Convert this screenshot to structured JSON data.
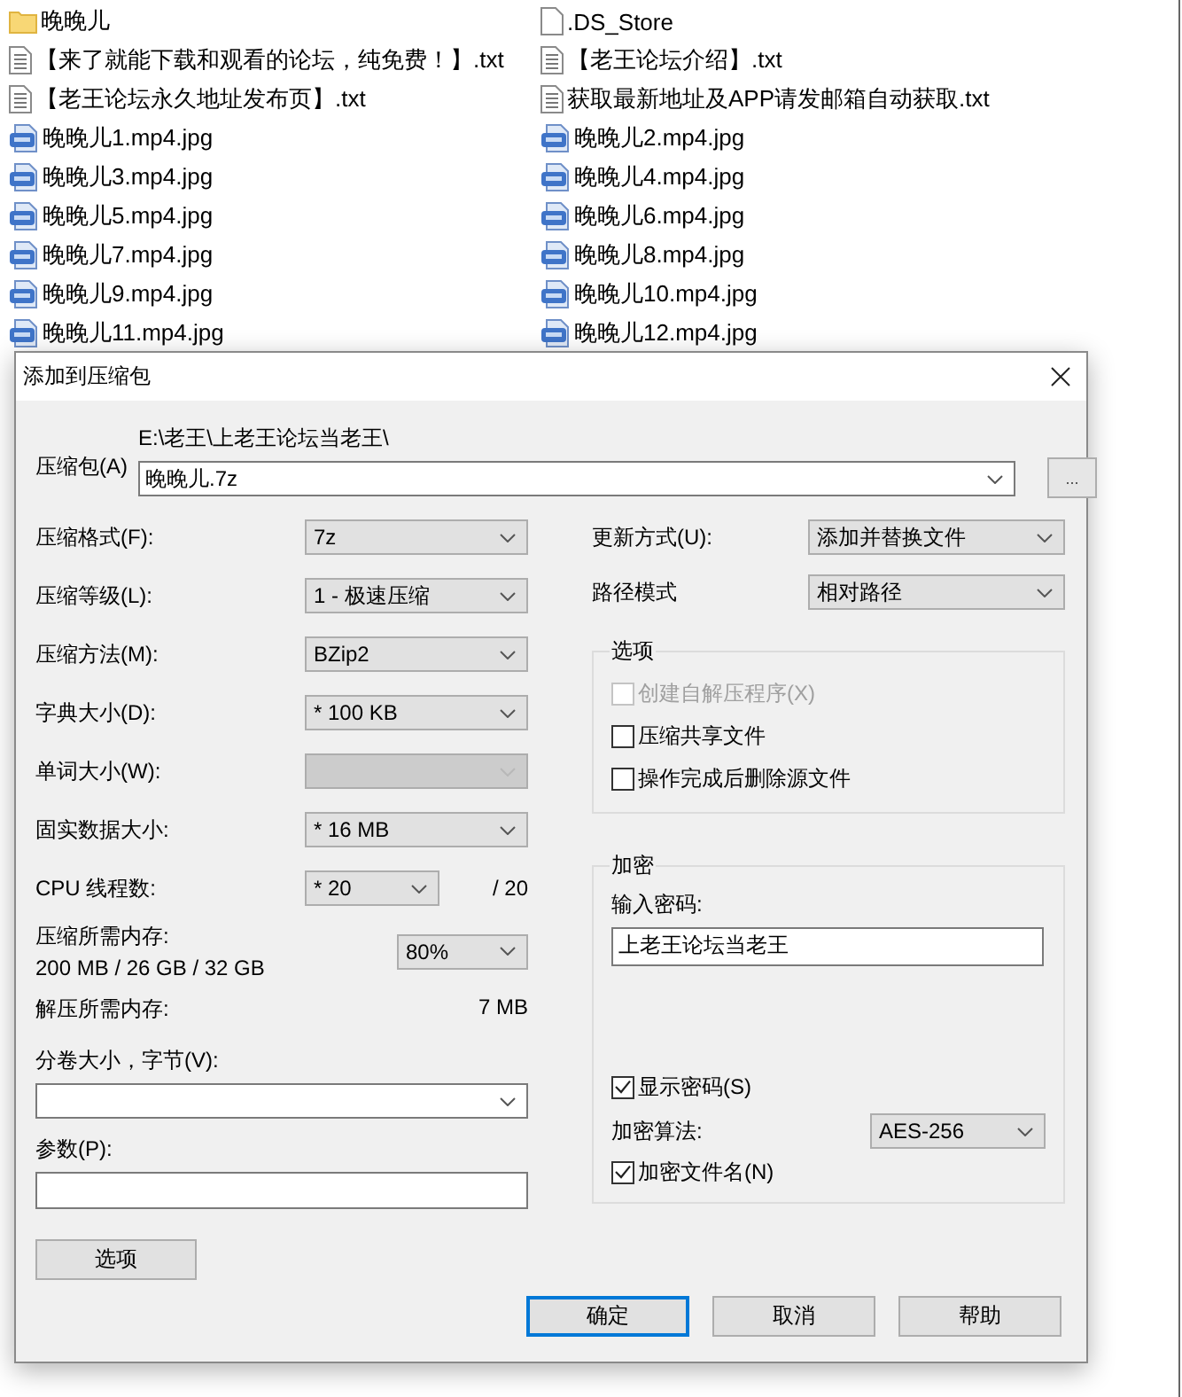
{
  "files": [
    {
      "name": "晚晚儿",
      "kind": "folder"
    },
    {
      "name": ".DS_Store",
      "kind": "file"
    },
    {
      "name": "【来了就能下载和观看的论坛，纯免费！】.txt",
      "kind": "text"
    },
    {
      "name": "【老王论坛介绍】.txt",
      "kind": "text"
    },
    {
      "name": "【老王论坛永久地址发布页】.txt",
      "kind": "text"
    },
    {
      "name": "获取最新地址及APP请发邮箱自动获取.txt",
      "kind": "text"
    },
    {
      "name": "晚晚儿1.mp4.jpg",
      "kind": "image"
    },
    {
      "name": "晚晚儿2.mp4.jpg",
      "kind": "image"
    },
    {
      "name": "晚晚儿3.mp4.jpg",
      "kind": "image"
    },
    {
      "name": "晚晚儿4.mp4.jpg",
      "kind": "image"
    },
    {
      "name": "晚晚儿5.mp4.jpg",
      "kind": "image"
    },
    {
      "name": "晚晚儿6.mp4.jpg",
      "kind": "image"
    },
    {
      "name": "晚晚儿7.mp4.jpg",
      "kind": "image"
    },
    {
      "name": "晚晚儿8.mp4.jpg",
      "kind": "image"
    },
    {
      "name": "晚晚儿9.mp4.jpg",
      "kind": "image"
    },
    {
      "name": "晚晚儿10.mp4.jpg",
      "kind": "image"
    },
    {
      "name": "晚晚儿11.mp4.jpg",
      "kind": "image"
    },
    {
      "name": "晚晚儿12.mp4.jpg",
      "kind": "image"
    }
  ],
  "dialog": {
    "title": "添加到压缩包",
    "archive": {
      "label": "压缩包(A)",
      "path": "E:\\老王\\上老王论坛当老王\\",
      "value": "晚晚儿.7z",
      "browse": "..."
    },
    "settings": [
      {
        "kind": "select",
        "label": "压缩格式(F):",
        "value": "7z",
        "disabled": false
      },
      {
        "kind": "select",
        "label": "压缩等级(L):",
        "value": "1 - 极速压缩",
        "disabled": false
      },
      {
        "kind": "select",
        "label": "压缩方法(M):",
        "value": "BZip2",
        "disabled": false
      },
      {
        "kind": "select",
        "label": "字典大小(D):",
        "value": "* 100 KB",
        "disabled": false
      },
      {
        "kind": "select",
        "label": "单词大小(W):",
        "disabled": true
      },
      {
        "kind": "select",
        "label": "固实数据大小:",
        "value": "* 16 MB",
        "disabled": false
      },
      {
        "kind": "threads",
        "label": "CPU 线程数:",
        "value": "* 20",
        "total": "/ 20"
      },
      {
        "kind": "memory",
        "label": "压缩所需内存:",
        "detail": "200 MB / 26 GB / 32 GB",
        "value": "80%"
      },
      {
        "kind": "info",
        "label": "解压所需内存:",
        "value": "7 MB"
      }
    ],
    "volume": {
      "label": "分卷大小，字节(V):"
    },
    "parameters": {
      "label": "参数(P):"
    },
    "options_button": "选项",
    "update_mode": {
      "label": "更新方式(U):",
      "value": "添加并替换文件"
    },
    "path_mode": {
      "label": "路径模式",
      "value": "相对路径"
    },
    "options": {
      "title": "选项",
      "checkboxes": [
        {
          "label": "创建自解压程序(X)",
          "checked": false,
          "disabled": true
        },
        {
          "label": "压缩共享文件",
          "checked": false,
          "disabled": false
        },
        {
          "label": "操作完成后删除源文件",
          "checked": false,
          "disabled": false
        }
      ]
    },
    "encryption": {
      "title": "加密",
      "password_label": "输入密码:",
      "password": "上老王论坛当老王",
      "show_password": {
        "label": "显示密码(S)",
        "checked": true
      },
      "method_label": "加密算法:",
      "method": "AES-256",
      "encrypt_names": {
        "label": "加密文件名(N)",
        "checked": true
      }
    },
    "buttons": [
      {
        "label": "确定",
        "default": true
      },
      {
        "label": "取消",
        "default": false
      },
      {
        "label": "帮助",
        "default": false
      }
    ]
  }
}
